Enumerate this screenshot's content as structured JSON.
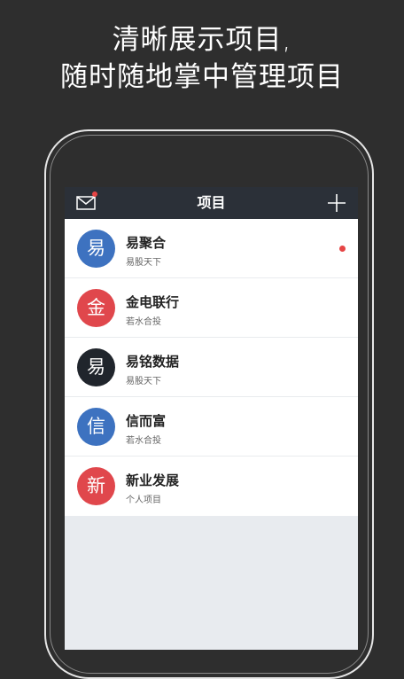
{
  "promo": {
    "line1": "清晰展示项目,",
    "line2": "随时随地掌中管理项目"
  },
  "navbar": {
    "title": "项目",
    "mail_icon": "mail-icon",
    "add_icon": "plus-icon"
  },
  "projects": [
    {
      "avatar_char": "易",
      "avatar_color": "#3d72c0",
      "name": "易聚合",
      "subtitle": "易股天下",
      "unread": true
    },
    {
      "avatar_char": "金",
      "avatar_color": "#e0474c",
      "name": "金电联行",
      "subtitle": "若水合投",
      "unread": false
    },
    {
      "avatar_char": "易",
      "avatar_color": "#20252c",
      "name": "易铭数据",
      "subtitle": "易股天下",
      "unread": false
    },
    {
      "avatar_char": "信",
      "avatar_color": "#3d72c0",
      "name": "信而富",
      "subtitle": "若水合投",
      "unread": false
    },
    {
      "avatar_char": "新",
      "avatar_color": "#e0474c",
      "name": "新业发展",
      "subtitle": "个人项目",
      "unread": false
    }
  ],
  "colors": {
    "background": "#2e2e2e",
    "navbar": "#2b3038",
    "badge": "#e64545",
    "screen_empty": "#e8ebef"
  }
}
